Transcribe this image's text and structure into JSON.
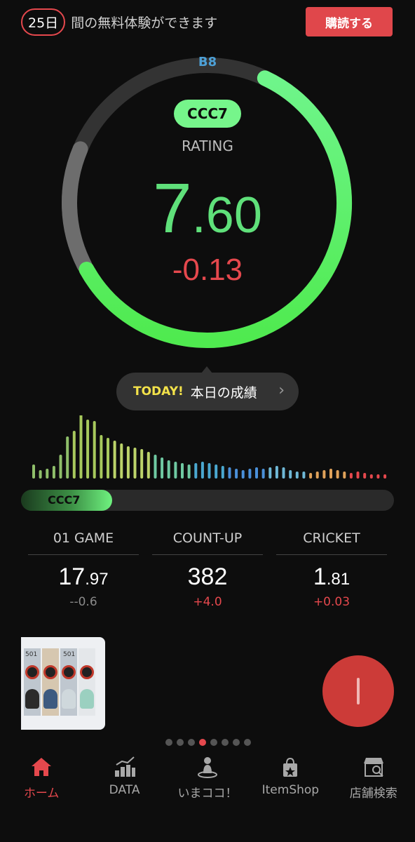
{
  "header": {
    "trial_days": "25日",
    "trial_text": "間の無料体験ができます",
    "subscribe_label": "購読する"
  },
  "rating": {
    "next_class": "B8",
    "current_class": "CCC7",
    "label": "RATING",
    "value_int": "7",
    "value_dec": ".60",
    "diff": "-0.13",
    "gauge_progress": 0.6
  },
  "today": {
    "tag": "TODAY!",
    "text": "本日の成績",
    "arrow": "›"
  },
  "distribution": {
    "bar_heights": [
      20,
      12,
      14,
      18,
      34,
      60,
      68,
      92,
      84,
      82,
      62,
      58,
      54,
      50,
      46,
      44,
      42,
      38,
      34,
      30,
      26,
      24,
      22,
      20,
      22,
      24,
      22,
      20,
      18,
      16,
      14,
      12,
      14,
      16,
      14,
      16,
      18,
      16,
      12,
      10,
      10,
      8,
      10,
      12,
      14,
      12,
      10,
      8,
      10,
      8,
      6,
      6,
      6
    ],
    "colors": [
      "#8fbf6a",
      "#a7c95d",
      "#bcd36a",
      "#6fc9a2",
      "#4aa8d0",
      "#4a90d9",
      "#6fb8d6",
      "#e0a25a",
      "#e5484d"
    ],
    "marker_index": 11
  },
  "progress": {
    "label": "CCC7",
    "fill": 0.245
  },
  "stats": [
    {
      "name": "01 GAME",
      "value_int": "17",
      "value_dec": ".97",
      "diff": "--0.6",
      "trend": "neutral"
    },
    {
      "name": "COUNT-UP",
      "value_int": "382",
      "value_dec": "",
      "diff": "+4.0",
      "trend": "up"
    },
    {
      "name": "CRICKET",
      "value_int": "1",
      "value_dec": ".81",
      "diff": "+0.03",
      "trend": "up"
    }
  ],
  "banner": {
    "board_labels": [
      "501",
      "501"
    ]
  },
  "pager": {
    "count": 8,
    "active": 3
  },
  "tabbar": [
    {
      "label": "ホーム",
      "icon": "home-icon",
      "active": true
    },
    {
      "label": "DATA",
      "icon": "chart-icon",
      "active": false
    },
    {
      "label": "いまココ！",
      "icon": "location-person-icon",
      "active": false
    },
    {
      "label": "ItemShop",
      "icon": "shopping-bag-icon",
      "active": false
    },
    {
      "label": "店舗検索",
      "icon": "store-search-icon",
      "active": false
    }
  ],
  "colors": {
    "accent_red": "#e5484d",
    "rating_green": "#5fe07a",
    "class_blue": "#4da0d6",
    "today_yellow": "#f3e24a"
  }
}
